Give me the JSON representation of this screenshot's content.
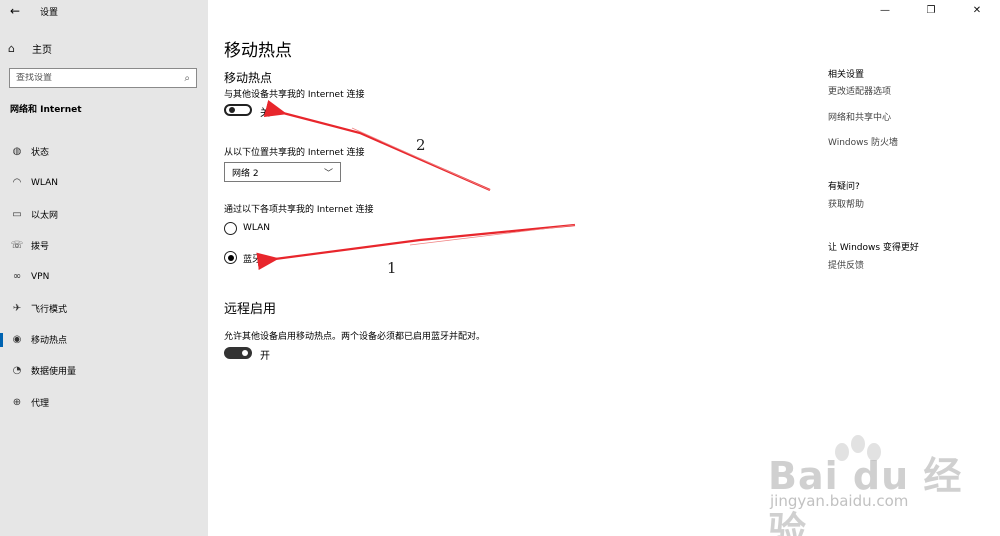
{
  "app": {
    "title": "设置",
    "back_icon": "←"
  },
  "window_controls": {
    "minimize": "—",
    "maximize": "❐",
    "close": "✕"
  },
  "sidebar": {
    "home_label": "主页",
    "search_placeholder": "查找设置",
    "section_title": "网络和 Internet",
    "items": [
      {
        "label": "状态",
        "icon": "globe-icon"
      },
      {
        "label": "WLAN",
        "icon": "wifi-icon"
      },
      {
        "label": "以太网",
        "icon": "ethernet-icon"
      },
      {
        "label": "拨号",
        "icon": "dialup-icon"
      },
      {
        "label": "VPN",
        "icon": "vpn-icon"
      },
      {
        "label": "飞行模式",
        "icon": "airplane-icon"
      },
      {
        "label": "移动热点",
        "icon": "hotspot-icon",
        "active": true
      },
      {
        "label": "数据使用量",
        "icon": "data-usage-icon"
      },
      {
        "label": "代理",
        "icon": "proxy-globe-icon"
      }
    ]
  },
  "main": {
    "title": "移动热点",
    "hotspot": {
      "heading": "移动热点",
      "share_desc": "与其他设备共享我的 Internet 连接",
      "toggle_label": "关",
      "toggle_state": "off",
      "from_desc": "从以下位置共享我的 Internet 连接",
      "from_selected": "网络 2",
      "over_desc": "通过以下各项共享我的 Internet 连接",
      "option_wlan": "WLAN",
      "option_bluetooth": "蓝牙",
      "selected_option": "蓝牙"
    },
    "remote": {
      "heading": "远程启用",
      "desc": "允许其他设备启用移动热点。两个设备必须都已启用蓝牙并配对。",
      "toggle_label": "开",
      "toggle_state": "on"
    }
  },
  "right": {
    "related_heading": "相关设置",
    "related_links": [
      "更改适配器选项",
      "网络和共享中心",
      "Windows 防火墙"
    ],
    "question_heading": "有疑问?",
    "help_link": "获取帮助",
    "improve_heading": "让 Windows 变得更好",
    "feedback_link": "提供反馈"
  },
  "annotations": {
    "label_1": "1",
    "label_2": "2",
    "arrow_color": "#e8262c"
  },
  "watermark": {
    "text": "Bai du 经验",
    "url": "jingyan.baidu.com"
  }
}
